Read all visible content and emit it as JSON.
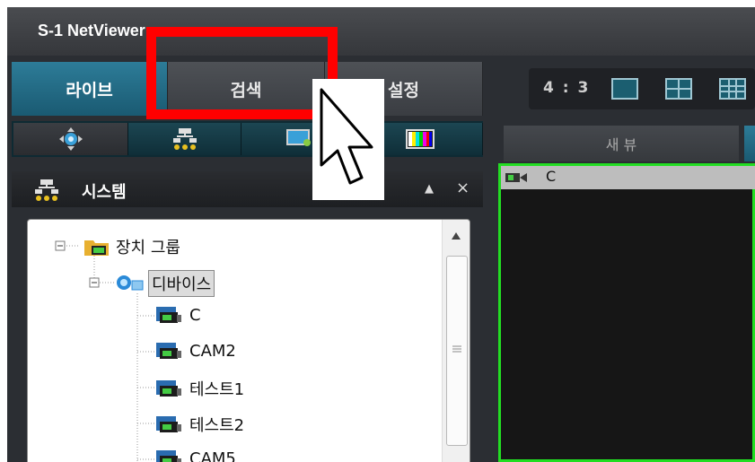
{
  "window": {
    "title": "S-1 NetViewer"
  },
  "main_tabs": [
    "라이브",
    "검색",
    "설정"
  ],
  "sub_tabs": [
    "ptz-icon",
    "network-tree-icon",
    "monitor-user-icon",
    "color-bars-icon"
  ],
  "system_panel": {
    "title": "시스템",
    "collapse_glyph": "▲",
    "close_glyph": "×"
  },
  "tree": {
    "root": "장치 그룹",
    "group": "디바이스",
    "devices": [
      "C",
      "CAM2",
      "테스트1",
      "테스트2",
      "CAM5"
    ]
  },
  "view": {
    "aspect_ratio": "4 : 3",
    "layouts": [
      "single-layout-icon",
      "quad-layout-icon",
      "nine-layout-icon"
    ],
    "view_tab": "새 뷰",
    "camera_label": "C"
  },
  "colors": {
    "accent": "#2d7c98",
    "highlight": "#ff0000",
    "active_camera": "#22dd22"
  }
}
